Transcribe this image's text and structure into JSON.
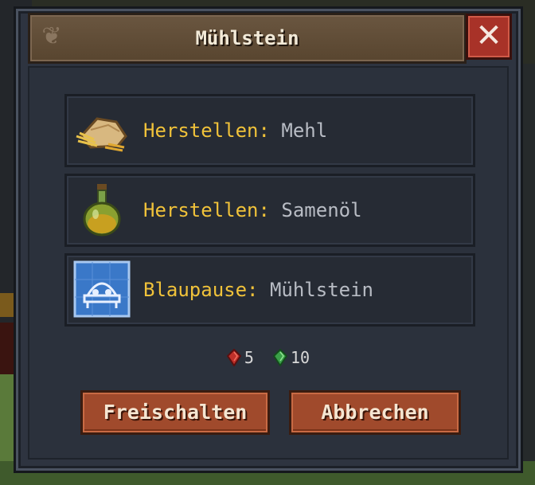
{
  "window": {
    "title": "Mühlstein",
    "close_symbol": "✕"
  },
  "options": [
    {
      "verb": "Herstellen:",
      "target": "Mehl",
      "icon": "flour-sack-icon"
    },
    {
      "verb": "Herstellen:",
      "target": "Samenöl",
      "icon": "oil-flask-icon"
    },
    {
      "verb": "Blaupause:",
      "target": "Mühlstein",
      "icon": "blueprint-icon"
    }
  ],
  "costs": [
    {
      "amount": "5",
      "icon": "red-gem-icon",
      "color": "#c0302a"
    },
    {
      "amount": "10",
      "icon": "green-gem-icon",
      "color": "#3aa048"
    }
  ],
  "buttons": {
    "unlock": "Freischalten",
    "cancel": "Abbrechen"
  }
}
